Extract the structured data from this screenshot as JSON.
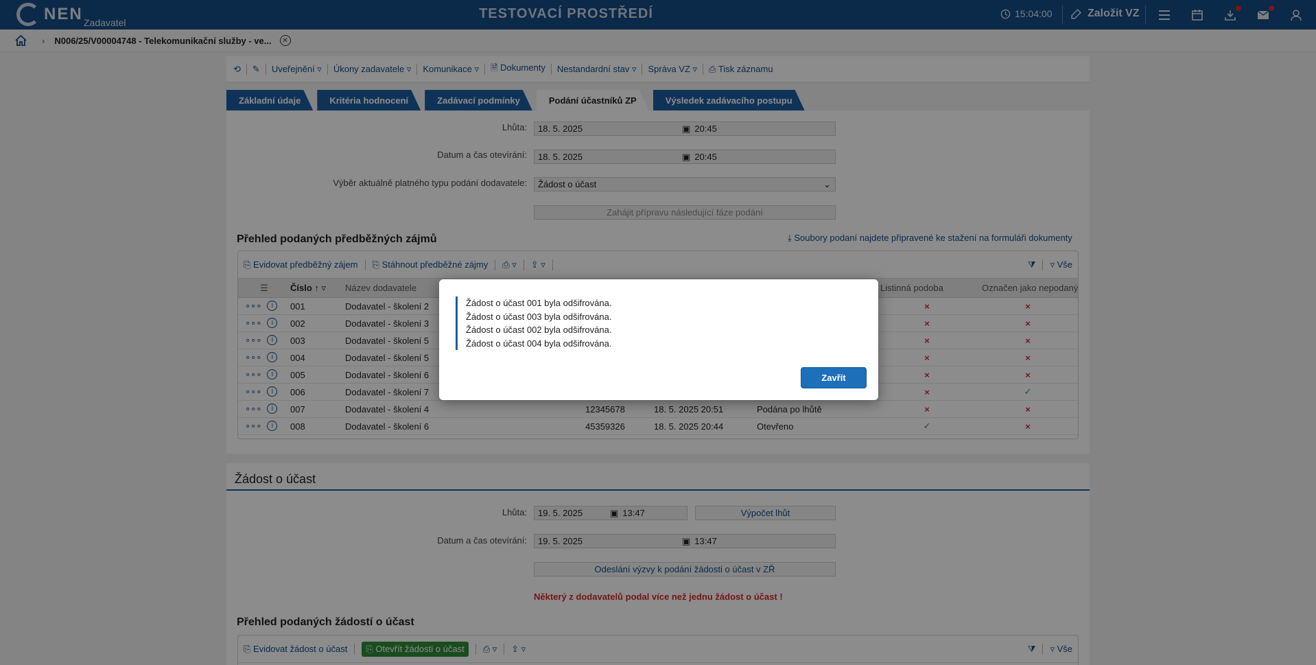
{
  "header": {
    "brand": "NEN",
    "brand_sub": "Zadavatel",
    "environment": "TESTOVACÍ PROSTŘEDÍ",
    "time": "15:04:00",
    "new_vz": "Založit VZ"
  },
  "breadcrumb": {
    "title": "N006/25/V00004748 - Telekomunikační služby - ve..."
  },
  "toolbar": {
    "items": [
      "Uveřejnění",
      "Úkony zadavatele",
      "Komunikace",
      "Dokumenty",
      "Nestandardní stav",
      "Správa VZ",
      "Tisk záznamu"
    ]
  },
  "tabs": [
    "Základní údaje",
    "Kritéria hodnocení",
    "Zadávací podmínky",
    "Podání účastníků ZP",
    "Výsledek zadávacího postupu"
  ],
  "form1": {
    "deadline_label": "Lhůta:",
    "deadline_date": "18. 5. 2025",
    "deadline_time": "20:45",
    "open_label": "Datum a čas otevírání:",
    "open_date": "18. 5. 2025",
    "open_time": "20:45",
    "type_label": "Výběr aktuálně platného typu podání dodavatele:",
    "type_value": "Žádost o účast",
    "next_phase": "Zahájit přípravu následující fáze podání"
  },
  "section1": {
    "title": "Přehled podaných předběžných zájmů",
    "files_link": "Soubory podaní najdete připravené ke stažení na formuláři dokumenty",
    "tool_register": "Evidovat předběžný zájem",
    "tool_download": "Stáhnout předběžné zájmy",
    "filter_all": "Vše",
    "columns": {
      "number": "Číslo",
      "supplier": "Název dodavatele",
      "paper": "Listinná podoba",
      "not_submitted": "Označen jako nepodaný"
    },
    "rows": [
      {
        "number": "001",
        "supplier": "Dodavatel - školení 2",
        "ico": "",
        "date": "",
        "state": "",
        "paper": "×",
        "paper_ok": false,
        "ns": "×",
        "ns_ok": false
      },
      {
        "number": "002",
        "supplier": "Dodavatel - školení 3",
        "ico": "",
        "date": "",
        "state": "",
        "paper": "×",
        "paper_ok": false,
        "ns": "×",
        "ns_ok": false
      },
      {
        "number": "003",
        "supplier": "Dodavatel - školení 5",
        "ico": "",
        "date": "",
        "state": "",
        "paper": "×",
        "paper_ok": false,
        "ns": "×",
        "ns_ok": false
      },
      {
        "number": "004",
        "supplier": "Dodavatel - školení 5",
        "ico": "",
        "date": "",
        "state": "",
        "paper": "×",
        "paper_ok": false,
        "ns": "×",
        "ns_ok": false
      },
      {
        "number": "005",
        "supplier": "Dodavatel - školení 6",
        "ico": "",
        "date": "",
        "state": "",
        "paper": "×",
        "paper_ok": false,
        "ns": "×",
        "ns_ok": false
      },
      {
        "number": "006",
        "supplier": "Dodavatel - školení 7",
        "ico": "",
        "date": "",
        "state": "",
        "paper": "×",
        "paper_ok": false,
        "ns": "✓",
        "ns_ok": true
      },
      {
        "number": "007",
        "supplier": "Dodavatel - školení 4",
        "ico": "12345678",
        "date": "18. 5. 2025 20:51",
        "state": "Podána po lhůtě",
        "paper": "×",
        "paper_ok": false,
        "ns": "×",
        "ns_ok": false
      },
      {
        "number": "008",
        "supplier": "Dodavatel - školení 6",
        "ico": "45359326",
        "date": "18. 5. 2025 20:44",
        "state": "Otevřeno",
        "paper": "✓",
        "paper_ok": true,
        "ns": "×",
        "ns_ok": false
      }
    ]
  },
  "section2": {
    "title": "Žádost o účast",
    "deadline_label": "Lhůta:",
    "deadline_date": "19. 5. 2025",
    "deadline_time": "13:47",
    "calc": "Výpočet lhůt",
    "open_label": "Datum a čas otevírání:",
    "open_date": "19. 5. 2025",
    "open_time": "13:47",
    "invite": "Odeslání výzvy k podání žádosti o účast v ZŘ",
    "warning": "Některý z dodavatelů podal více než jednu žádost o účast !",
    "list_title": "Přehled podaných žádostí o účast",
    "tool_register": "Evidovat žádost o účast",
    "tool_open": "Otevřít žádosti o účast",
    "filter_all": "Vše"
  },
  "modal": {
    "messages": [
      "Žádost o účast 001 byla odšifrována.",
      "Žádost o účast 003 byla odšifrována.",
      "Žádost o účast 002 byla odšifrována.",
      "Žádost o účast 004 byla odšifrována."
    ],
    "close": "Zavřít"
  },
  "colors": {
    "header": "#144b84",
    "accent": "#1c5ea1",
    "error": "#d62828",
    "ok": "#2e9e36"
  }
}
